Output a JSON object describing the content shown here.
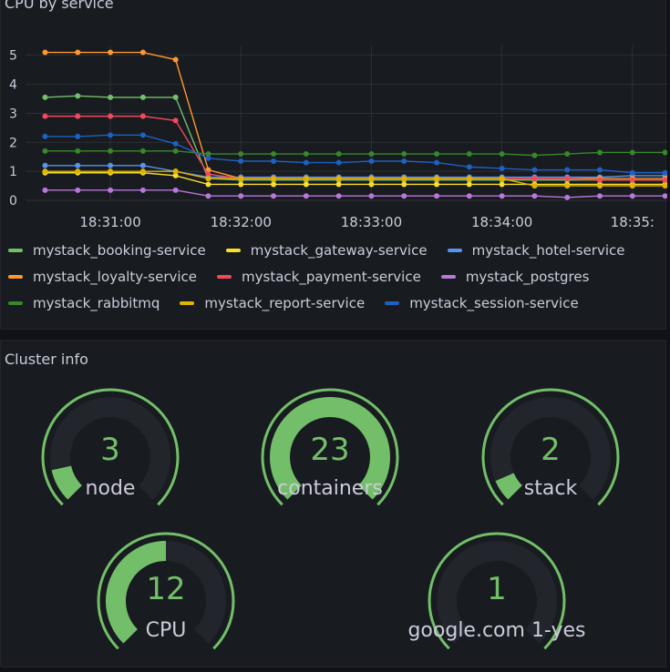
{
  "cpu_panel": {
    "title": "CPU by service"
  },
  "cluster_panel": {
    "title": "Cluster info"
  },
  "chart_data": {
    "type": "line",
    "title": "CPU by service",
    "xlabel": "",
    "ylabel": "",
    "ylim": [
      0,
      5.4
    ],
    "yticks": [
      0,
      1,
      2,
      3,
      4,
      5
    ],
    "xlim": [
      "18:30:21",
      "18:35:16"
    ],
    "xticks": [
      "18:31:00",
      "18:32:00",
      "18:33:00",
      "18:34:00",
      "18:35:00"
    ],
    "xtick_labels": [
      "18:31:00",
      "18:32:00",
      "18:33:00",
      "18:34:00",
      "18:35:"
    ],
    "grid": true,
    "legend_position": "bottom",
    "x": [
      "18:30:30",
      "18:30:45",
      "18:31:00",
      "18:31:15",
      "18:31:30",
      "18:31:45",
      "18:32:00",
      "18:32:15",
      "18:32:30",
      "18:32:45",
      "18:33:00",
      "18:33:15",
      "18:33:30",
      "18:33:45",
      "18:34:00",
      "18:34:15",
      "18:34:30",
      "18:34:45",
      "18:35:00",
      "18:35:15"
    ],
    "series": [
      {
        "name": "mystack_booking-service",
        "color": "#73bf69",
        "values": [
          3.55,
          3.6,
          3.55,
          3.55,
          3.55,
          0.75,
          0.7,
          0.7,
          0.7,
          0.7,
          0.7,
          0.7,
          0.7,
          0.7,
          0.7,
          0.7,
          0.7,
          0.7,
          0.7,
          0.7
        ]
      },
      {
        "name": "mystack_gateway-service",
        "color": "#fade2a",
        "values": [
          0.95,
          0.95,
          0.95,
          0.95,
          0.85,
          0.55,
          0.55,
          0.55,
          0.55,
          0.55,
          0.55,
          0.55,
          0.55,
          0.55,
          0.55,
          0.55,
          0.55,
          0.55,
          0.55,
          0.55
        ]
      },
      {
        "name": "mystack_hotel-service",
        "color": "#5794f2",
        "values": [
          1.2,
          1.2,
          1.2,
          1.2,
          1.0,
          0.8,
          0.8,
          0.8,
          0.8,
          0.8,
          0.8,
          0.8,
          0.8,
          0.8,
          0.8,
          0.8,
          0.8,
          0.8,
          0.85,
          0.85
        ]
      },
      {
        "name": "mystack_loyalty-service",
        "color": "#ff9830",
        "values": [
          5.1,
          5.1,
          5.1,
          5.1,
          4.85,
          1.05,
          0.75,
          0.75,
          0.75,
          0.75,
          0.75,
          0.75,
          0.75,
          0.75,
          0.75,
          0.75,
          0.75,
          0.75,
          0.75,
          0.75
        ]
      },
      {
        "name": "mystack_payment-service",
        "color": "#f2495c",
        "values": [
          2.9,
          2.9,
          2.9,
          2.9,
          2.75,
          0.9,
          0.75,
          0.75,
          0.75,
          0.75,
          0.75,
          0.75,
          0.75,
          0.75,
          0.75,
          0.75,
          0.75,
          0.7,
          0.7,
          0.7
        ]
      },
      {
        "name": "mystack_postgres",
        "color": "#b877d9",
        "values": [
          0.35,
          0.35,
          0.35,
          0.35,
          0.35,
          0.15,
          0.15,
          0.15,
          0.15,
          0.15,
          0.15,
          0.15,
          0.15,
          0.15,
          0.15,
          0.15,
          0.1,
          0.15,
          0.15,
          0.15
        ]
      },
      {
        "name": "mystack_rabbitmq",
        "color": "#37872d",
        "values": [
          1.7,
          1.7,
          1.7,
          1.7,
          1.7,
          1.6,
          1.6,
          1.6,
          1.6,
          1.6,
          1.6,
          1.6,
          1.6,
          1.6,
          1.6,
          1.55,
          1.6,
          1.65,
          1.65,
          1.65
        ]
      },
      {
        "name": "mystack_report-service",
        "color": "#e0b400",
        "values": [
          1.0,
          1.0,
          1.0,
          1.0,
          1.0,
          0.75,
          0.75,
          0.75,
          0.75,
          0.75,
          0.75,
          0.75,
          0.75,
          0.75,
          0.75,
          0.5,
          0.5,
          0.5,
          0.5,
          0.5
        ]
      },
      {
        "name": "mystack_session-service",
        "color": "#1f60c4",
        "values": [
          2.2,
          2.2,
          2.25,
          2.25,
          1.95,
          1.45,
          1.35,
          1.35,
          1.3,
          1.3,
          1.35,
          1.35,
          1.3,
          1.15,
          1.1,
          1.05,
          1.05,
          1.05,
          0.95,
          0.95
        ]
      }
    ]
  },
  "gauges": [
    {
      "id": "node",
      "value": "3",
      "label": "node",
      "fraction": 0.12
    },
    {
      "id": "containers",
      "value": "23",
      "label": "containers",
      "fraction": 1.0
    },
    {
      "id": "stack",
      "value": "2",
      "label": "stack",
      "fraction": 0.08
    },
    {
      "id": "cpu",
      "value": "12",
      "label": "CPU",
      "fraction": 0.5
    },
    {
      "id": "google",
      "value": "1",
      "label": "google.com 1-yes",
      "fraction": 0.0
    }
  ],
  "colors": {
    "gauge_fill": "#73bf69",
    "gauge_track": "#22252b",
    "threshold": "#73bf69"
  }
}
